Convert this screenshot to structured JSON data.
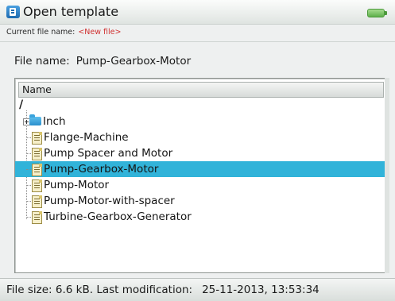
{
  "window": {
    "title": "Open template"
  },
  "header": {
    "current_file_label": "Current file name:",
    "current_file_value": "<New file>"
  },
  "file_name": {
    "label": "File name:",
    "value": "Pump-Gearbox-Motor"
  },
  "file_list": {
    "column_header": "Name",
    "root": "/",
    "items": [
      {
        "label": "Inch",
        "type": "folder",
        "selected": false
      },
      {
        "label": "Flange-Machine",
        "type": "file",
        "selected": false
      },
      {
        "label": "Pump Spacer and Motor",
        "type": "file",
        "selected": false
      },
      {
        "label": "Pump-Gearbox-Motor",
        "type": "file",
        "selected": true
      },
      {
        "label": "Pump-Motor",
        "type": "file",
        "selected": false
      },
      {
        "label": "Pump-Motor-with-spacer",
        "type": "file",
        "selected": false
      },
      {
        "label": "Turbine-Gearbox-Generator",
        "type": "file",
        "selected": false
      }
    ],
    "selection_color": "#31b3d9"
  },
  "status": {
    "file_size": "File size: 6.6 kB.",
    "last_modification_label": "Last modification:",
    "last_modification_value": "25-11-2013, 13:53:34"
  },
  "icons": {
    "app": "open-template-icon",
    "battery": "battery-icon",
    "folder": "folder-icon",
    "file": "template-file-icon"
  }
}
